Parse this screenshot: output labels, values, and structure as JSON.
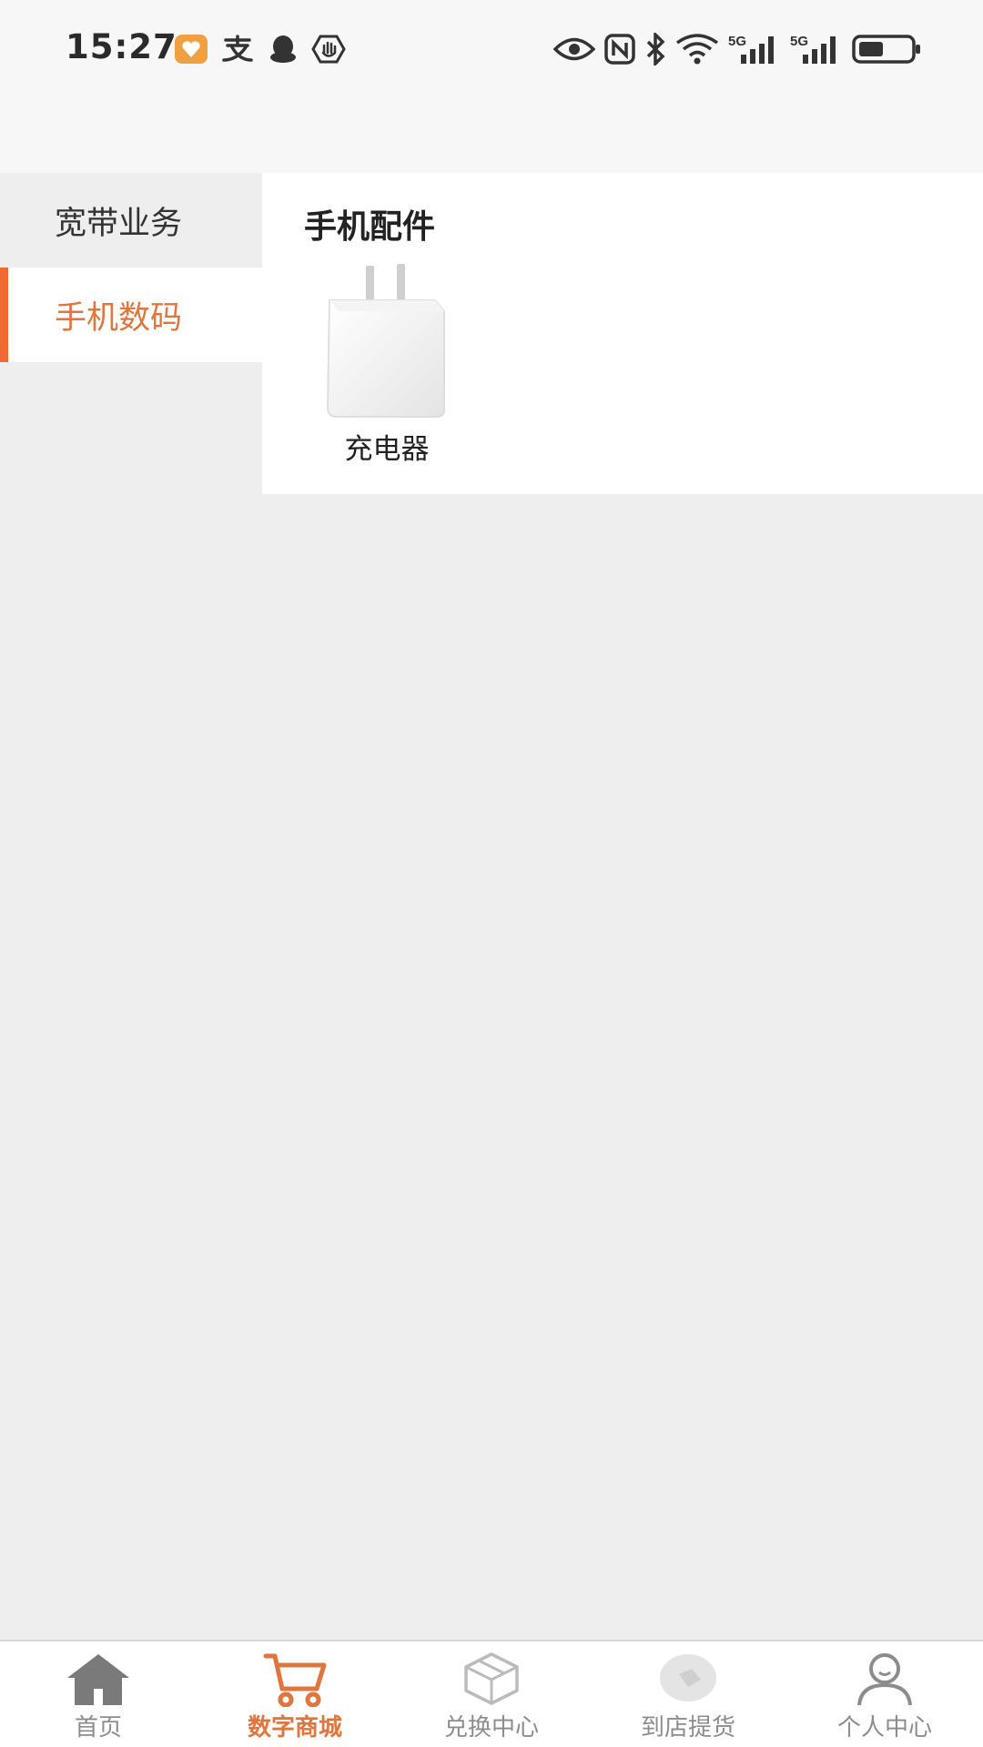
{
  "status_bar": {
    "time": "15:27"
  },
  "sidebar": {
    "items": [
      {
        "label": "宽带业务",
        "active": false
      },
      {
        "label": "手机数码",
        "active": true
      }
    ]
  },
  "content": {
    "section_title": "手机配件",
    "products": [
      {
        "name": "充电器"
      }
    ]
  },
  "tabbar": {
    "tabs": [
      {
        "label": "首页",
        "icon": "home-icon"
      },
      {
        "label": "数字商城",
        "icon": "cart-icon",
        "active": true
      },
      {
        "label": "兑换中心",
        "icon": "exchange-box-icon"
      },
      {
        "label": "到店提货",
        "icon": "pickup-icon"
      },
      {
        "label": "个人中心",
        "icon": "user-icon"
      }
    ]
  },
  "colors": {
    "accent": "#e1753e",
    "accent_bar": "#f26a33",
    "background": "#eeeeee",
    "panel": "#ffffff"
  }
}
